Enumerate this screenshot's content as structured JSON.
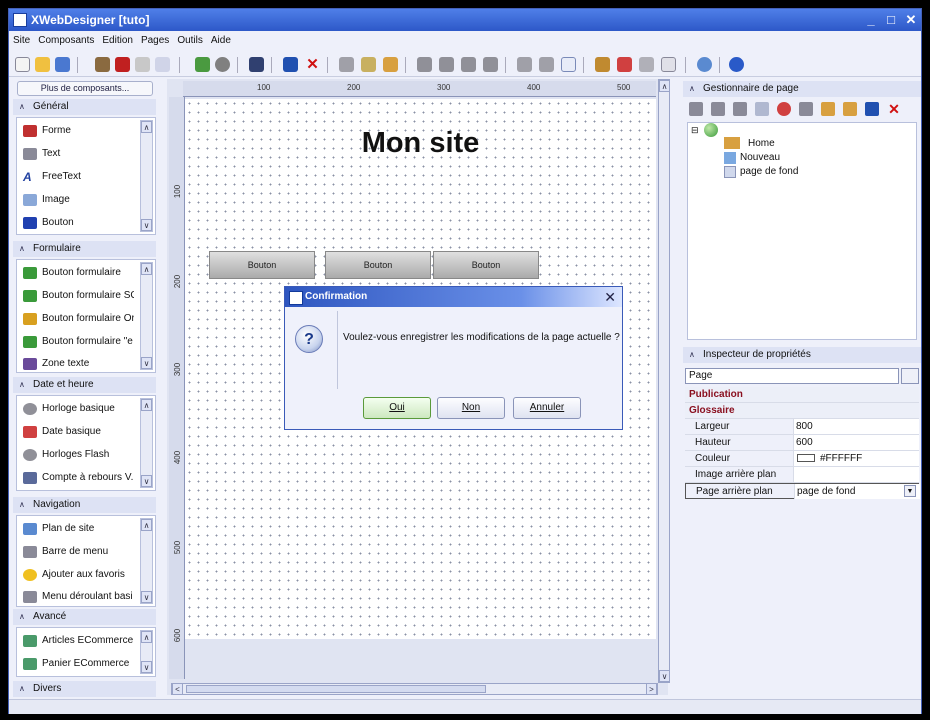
{
  "app": {
    "title": "XWebDesigner  [tuto]"
  },
  "menu": [
    "Site",
    "Composants",
    "Edition",
    "Pages",
    "Outils",
    "Aide"
  ],
  "window_controls": {
    "minimize": "_",
    "maximize": "□",
    "close": "✕"
  },
  "left_panel": {
    "more_button": "Plus de composants...",
    "categories": [
      {
        "name": "Général",
        "items": [
          "Forme",
          "Text",
          "FreeText",
          "Image",
          "Bouton"
        ]
      },
      {
        "name": "Formulaire",
        "items": [
          "Bouton formulaire",
          "Bouton formulaire SC",
          "Bouton formulaire Or",
          "Bouton formulaire \"e",
          "Zone texte"
        ]
      },
      {
        "name": "Date et heure",
        "items": [
          "Horloge basique",
          "Date basique",
          "Horloges Flash",
          "Compte à rebours V."
        ]
      },
      {
        "name": "Navigation",
        "items": [
          "Plan de site",
          "Barre de menu",
          "Ajouter aux favoris",
          "Menu déroulant basi"
        ]
      },
      {
        "name": "Avancé",
        "items": [
          "Articles ECommerce",
          "Panier ECommerce"
        ]
      },
      {
        "name": "Divers",
        "items": []
      }
    ]
  },
  "canvas": {
    "ruler_h": [
      "100",
      "200",
      "300",
      "400",
      "500"
    ],
    "ruler_v": [
      "100",
      "200",
      "300",
      "400",
      "500",
      "600"
    ],
    "page_title": "Mon site",
    "page_buttons": [
      "Bouton",
      "Bouton",
      "Bouton"
    ]
  },
  "dialog": {
    "title": "Confirmation",
    "close": "✕",
    "icon": "?",
    "message": "Voulez-vous enregistrer les modifications de la page actuelle ?",
    "buttons": {
      "yes": "Oui",
      "no": "Non",
      "cancel": "Annuler"
    }
  },
  "page_manager": {
    "title": "Gestionnaire de page",
    "tree": [
      "Home",
      "Nouveau",
      "page de fond"
    ]
  },
  "inspector": {
    "title": "Inspecteur de propriétés",
    "selected": "Page",
    "groups": [
      "Publication",
      "Glossaire"
    ],
    "rows": [
      {
        "key": "Largeur",
        "value": "800"
      },
      {
        "key": "Hauteur",
        "value": "600"
      },
      {
        "key": "Couleur",
        "value": "#FFFFFF"
      },
      {
        "key": "Image arrière plan",
        "value": ""
      },
      {
        "key": "Page arrière plan",
        "value": "page de fond"
      }
    ]
  },
  "colors": {
    "titlebar": "#2d58c8",
    "accent": "#4f7fe8",
    "group_text": "#8a1020"
  }
}
